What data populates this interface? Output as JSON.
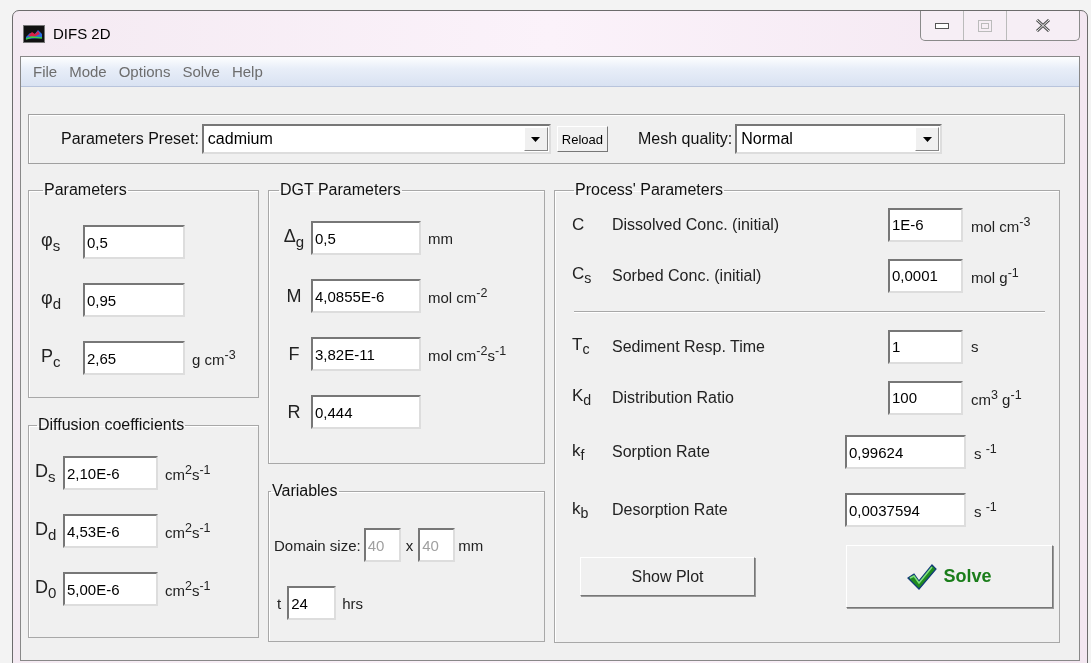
{
  "window": {
    "title": "DIFS 2D"
  },
  "menu": [
    {
      "label": "File"
    },
    {
      "label": "Mode"
    },
    {
      "label": "Options"
    },
    {
      "label": "Solve"
    },
    {
      "label": "Help"
    }
  ],
  "preset": {
    "label": "Parameters Preset:",
    "value": "cadmium",
    "reload_button": "Reload",
    "mesh_label": "Mesh quality:",
    "mesh_value": "Normal"
  },
  "parameters": {
    "title": "Parameters",
    "rows": [
      {
        "symbol": "φ$_{s}$",
        "value": "0,5"
      },
      {
        "symbol": "φ$_{d}$",
        "value": "0,95"
      },
      {
        "symbol": "P$_{c}$",
        "value": "2,65",
        "unit": "g cm$^{-3}$"
      }
    ]
  },
  "diffusion": {
    "title": "Diffusion coefficients",
    "rows": [
      {
        "symbol": "D$_{s}$",
        "value": "2,10E-6",
        "unit": "cm$^{2}$s$^{-1}$"
      },
      {
        "symbol": "D$_{d}$",
        "value": "4,53E-6",
        "unit": "cm$^{2}$s$^{-1}$"
      },
      {
        "symbol": "D$_{0}$",
        "value": "5,00E-6",
        "unit": "cm$^{2}$s$^{-1}$"
      }
    ]
  },
  "dgt": {
    "title": "DGT Parameters",
    "rows": [
      {
        "symbol": "Δ$_{g}$",
        "value": "0,5",
        "unit": "mm"
      },
      {
        "symbol": "M",
        "value": "4,0855E-6",
        "unit": "mol cm$^{-2}$"
      },
      {
        "symbol": "F",
        "value": "3,82E-11",
        "unit": "mol cm$^{-2}$s$^{-1}$"
      },
      {
        "symbol": "R",
        "value": "0,444"
      }
    ]
  },
  "variables": {
    "title": "Variables",
    "domain_label": "Domain size:",
    "domain_width": {
      "value": "40",
      "disabled": true
    },
    "times": "x",
    "domain_height": {
      "value": "40",
      "disabled": true
    },
    "domain_unit": "mm",
    "time": {
      "symbol": "t",
      "value": "24",
      "unit": "hrs"
    }
  },
  "process": {
    "title": "Process' Parameters",
    "rows": [
      {
        "kind": "value",
        "symbol": "C",
        "label": "Dissolved Conc. (initial)",
        "value": "1E-6",
        "unit": "mol cm$^{-3}$"
      },
      {
        "kind": "value",
        "symbol": "C$_{s}$",
        "label": "Sorbed Conc. (initial)",
        "value": "0,0001",
        "unit": "mol g$^{-1}$"
      },
      {
        "kind": "divider"
      },
      {
        "kind": "value",
        "symbol": "T$_{c}$",
        "label": "Sediment Resp. Time",
        "value": "1",
        "unit": "s"
      },
      {
        "kind": "value",
        "symbol": "K$_{d}$",
        "label": "Distribution Ratio",
        "value": "100",
        "unit": "cm$^{3}$ g$^{-1}$"
      },
      {
        "kind": "rate",
        "symbol": "k$_{f}$",
        "label": "Sorption Rate",
        "value": "0,99624",
        "unit": "s $^{-1}$"
      },
      {
        "kind": "rate",
        "symbol": "k$_{b}$",
        "label": "Desorption Rate",
        "value": "0,0037594",
        "unit": "s $^{-1}$"
      }
    ],
    "show_plot_button": "Show Plot",
    "solve_button": "Solve"
  }
}
